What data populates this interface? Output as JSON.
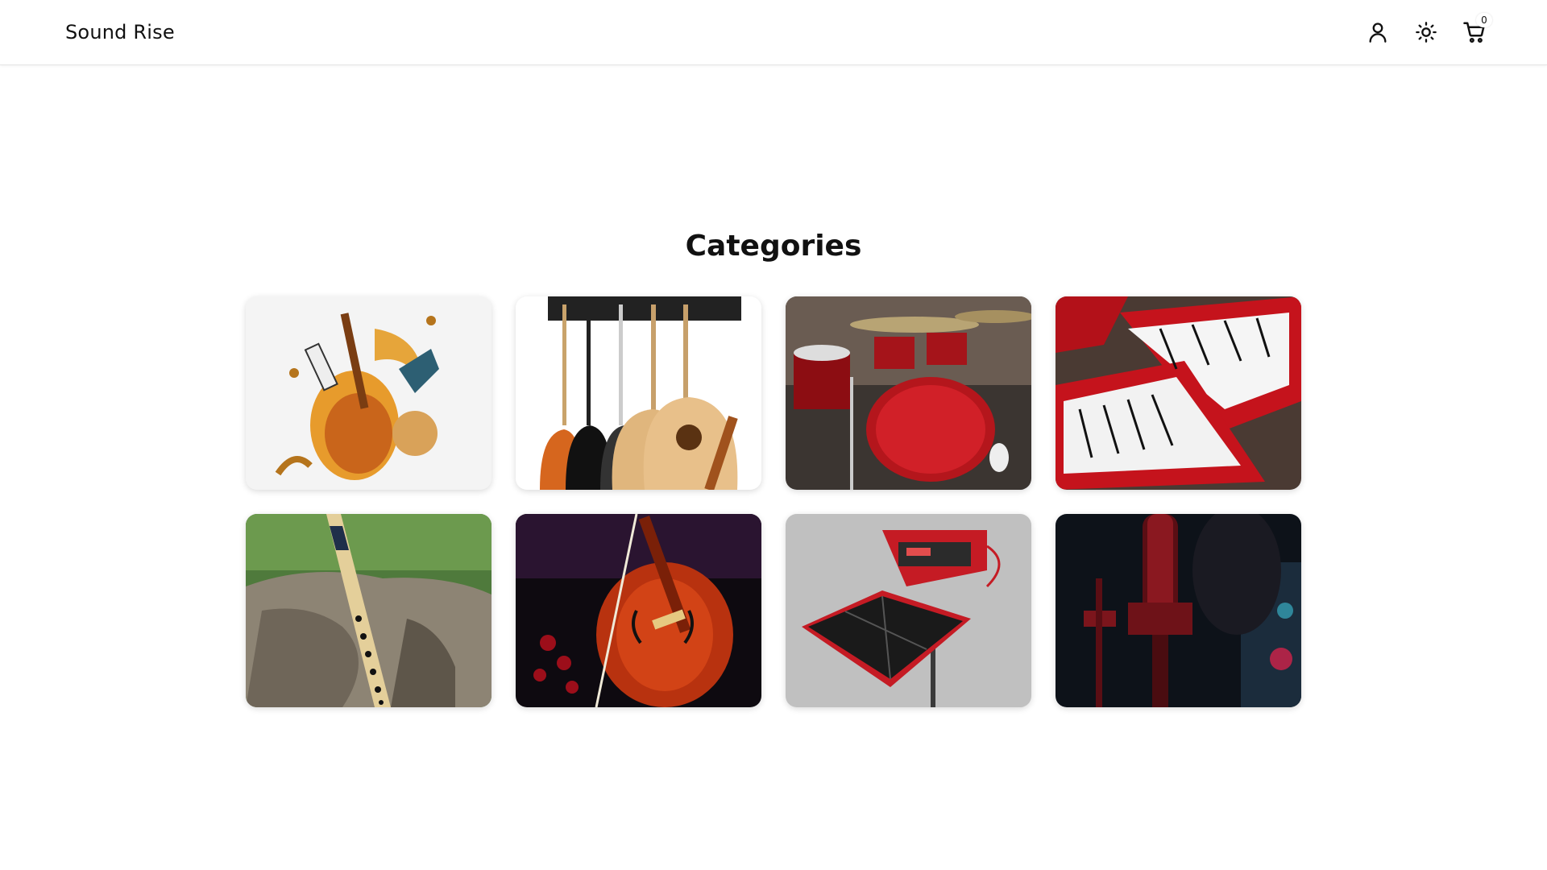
{
  "header": {
    "brand": "Sound Rise",
    "user_icon": "user-icon",
    "theme_icon": "sun-icon",
    "cart_icon": "shopping-cart-icon",
    "cart_count": "0"
  },
  "main": {
    "title": "Categories",
    "categories": [
      {
        "image": "assorted-instruments-illustration"
      },
      {
        "image": "guitars-on-rack"
      },
      {
        "image": "red-drum-kit"
      },
      {
        "image": "red-keyboards"
      },
      {
        "image": "bamboo-flute"
      },
      {
        "image": "violin-with-bow"
      },
      {
        "image": "electronic-drum-pad"
      },
      {
        "image": "studio-microphone"
      }
    ]
  },
  "colors": {
    "accent_red": "#d3202a",
    "text": "#111111",
    "background": "#ffffff"
  }
}
